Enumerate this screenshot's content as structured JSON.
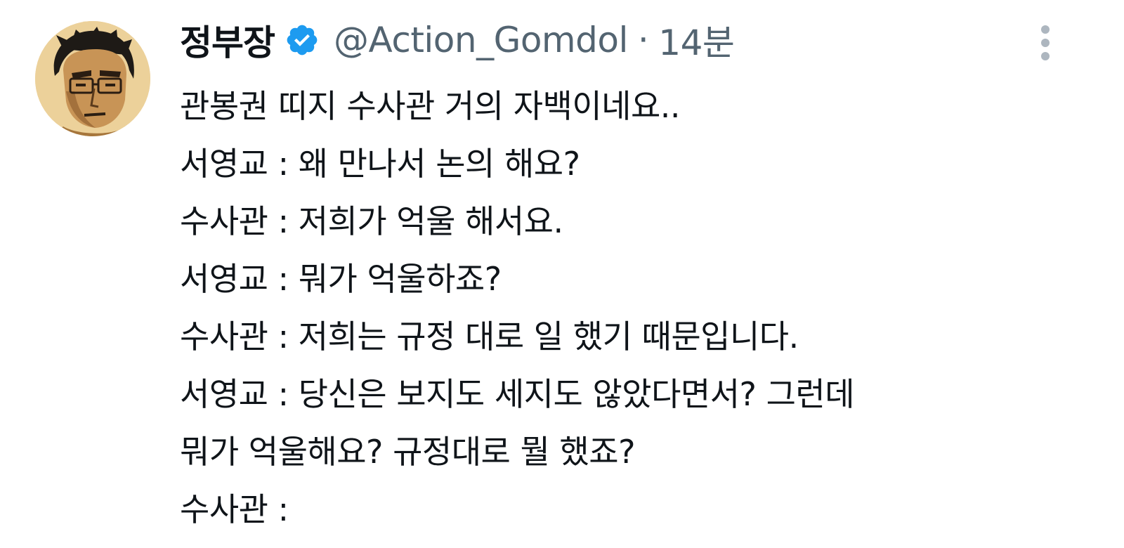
{
  "tweet": {
    "author": {
      "display_name": "정부장",
      "verified": true,
      "handle": "@Action_Gomdol",
      "separator": "·",
      "time": "14분"
    },
    "icons": {
      "verified": "verified-badge-icon",
      "more": "more-options-icon"
    },
    "colors": {
      "verified_badge": "#1d9bf0",
      "text": "#0f1419",
      "muted": "#536471"
    },
    "lines": [
      "관봉권 띠지 수사관 거의 자백이네요..",
      "서영교 : 왜 만나서 논의 해요?",
      "수사관 : 저희가 억울 해서요.",
      "서영교 : 뭐가 억울하죠?",
      "수사관 : 저희는 규정 대로 일 했기 때문입니다.",
      "서영교 : 당신은 보지도 세지도 않았다면서? 그런데",
      "뭐가 억울해요? 규정대로 뭘 했죠?",
      "수사관 :"
    ]
  }
}
